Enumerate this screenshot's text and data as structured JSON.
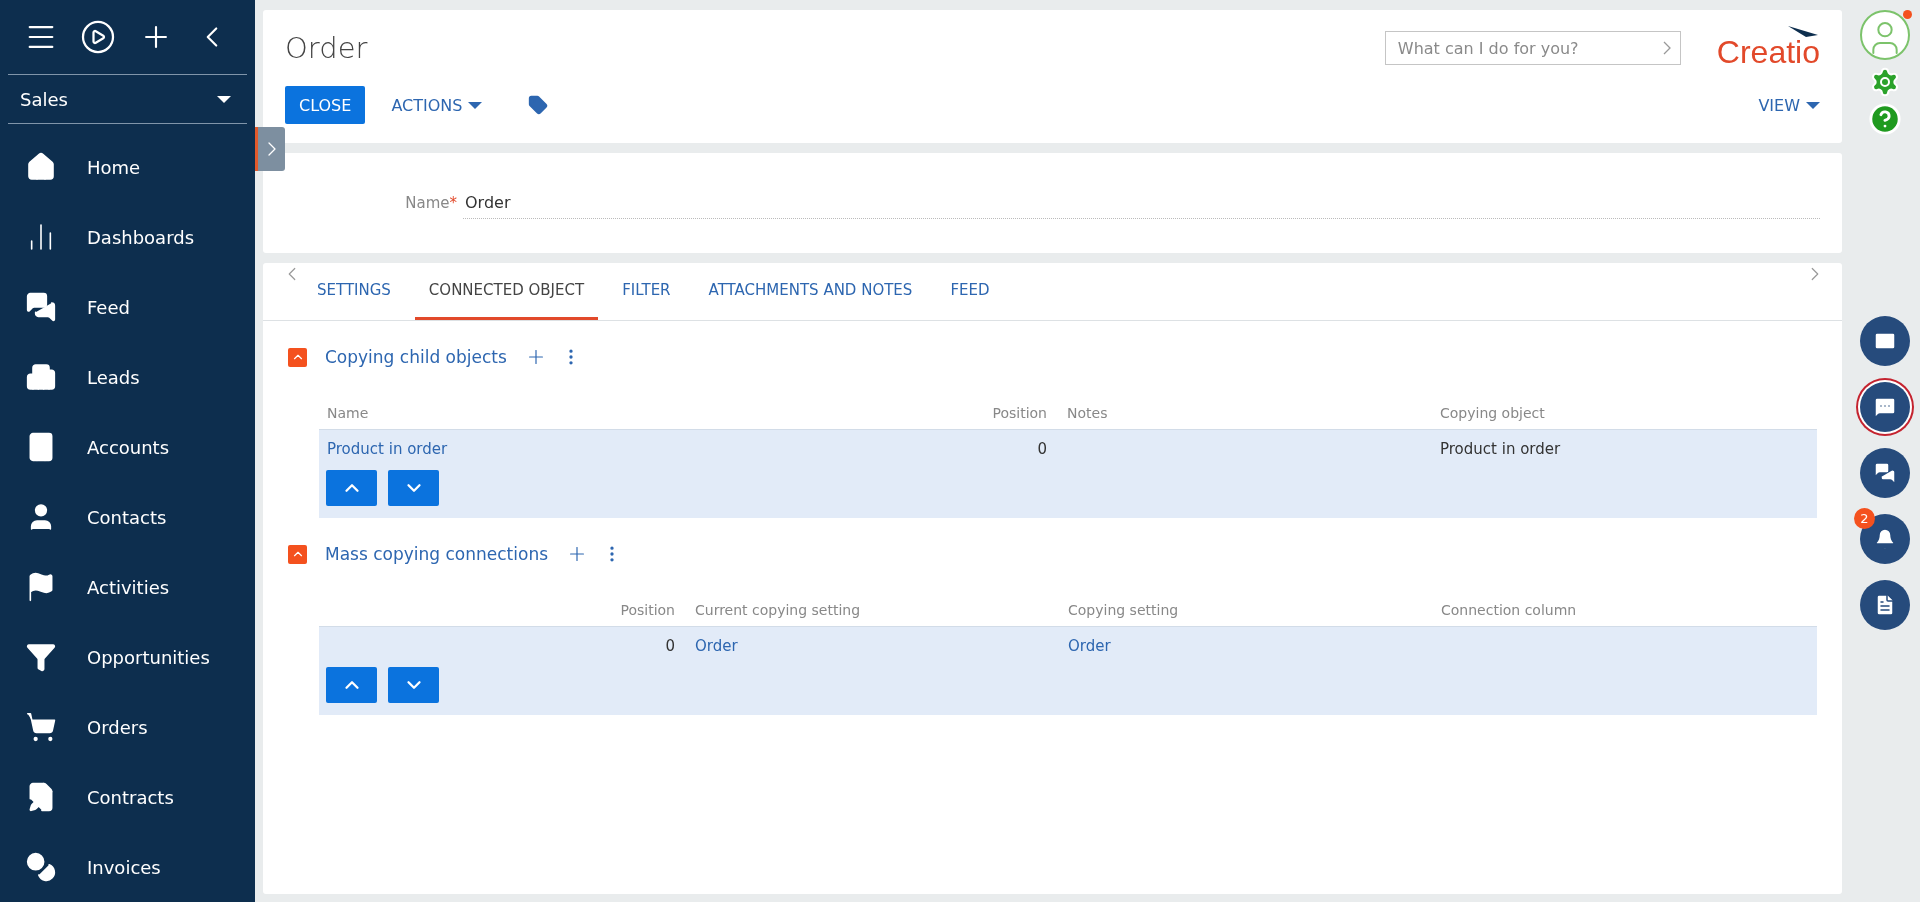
{
  "sidebar": {
    "workplace": "Sales",
    "items": [
      {
        "label": "Home"
      },
      {
        "label": "Dashboards"
      },
      {
        "label": "Feed"
      },
      {
        "label": "Leads"
      },
      {
        "label": "Accounts"
      },
      {
        "label": "Contacts"
      },
      {
        "label": "Activities"
      },
      {
        "label": "Opportunities"
      },
      {
        "label": "Orders"
      },
      {
        "label": "Contracts"
      },
      {
        "label": "Invoices"
      }
    ]
  },
  "header": {
    "title": "Order",
    "search": {
      "placeholder": "What can I do for you?"
    },
    "logo": "Creatio",
    "buttons": {
      "close": "CLOSE",
      "actions": "ACTIONS",
      "view": "VIEW"
    }
  },
  "form": {
    "label": "Name",
    "required_mark": "*",
    "value": "Order"
  },
  "tabs": [
    {
      "label": "SETTINGS",
      "selected": false
    },
    {
      "label": "CONNECTED OBJECT",
      "selected": true
    },
    {
      "label": "FILTER",
      "selected": false
    },
    {
      "label": "ATTACHMENTS AND NOTES",
      "selected": false
    },
    {
      "label": "FEED",
      "selected": false
    }
  ],
  "sections": [
    {
      "title": "Copying child objects",
      "expanded": true,
      "columns": [
        {
          "label": "Name",
          "kind": "text"
        },
        {
          "label": "Position",
          "kind": "number"
        },
        {
          "label": "Notes",
          "kind": "text"
        },
        {
          "label": "Copying object",
          "kind": "text"
        }
      ],
      "rows": [
        {
          "selected": true,
          "cells": [
            {
              "text": "Product in order",
              "kind": "link"
            },
            {
              "text": "0",
              "kind": "text"
            },
            null,
            {
              "text": "Product in order",
              "kind": "text"
            }
          ]
        }
      ]
    },
    {
      "title": "Mass copying connections",
      "expanded": true,
      "columns": [
        {
          "kind": "blank"
        },
        {
          "label": "Position",
          "kind": "number"
        },
        {
          "label": "Current copying setting",
          "kind": "text"
        },
        {
          "label": "Copying setting",
          "kind": "text"
        },
        {
          "label": "Connection column",
          "kind": "text"
        }
      ],
      "rows": [
        {
          "selected": true,
          "cells": [
            null,
            {
              "text": "0",
              "kind": "text"
            },
            {
              "text": "Order",
              "kind": "link"
            },
            {
              "text": "Order",
              "kind": "link"
            },
            null
          ]
        }
      ]
    }
  ],
  "right_bar": {
    "notifications_count": "2",
    "buttons": [
      {
        "selected": false
      },
      {
        "selected": true
      },
      {
        "selected": false
      },
      {
        "selected": false
      },
      {
        "selected": false
      }
    ]
  }
}
